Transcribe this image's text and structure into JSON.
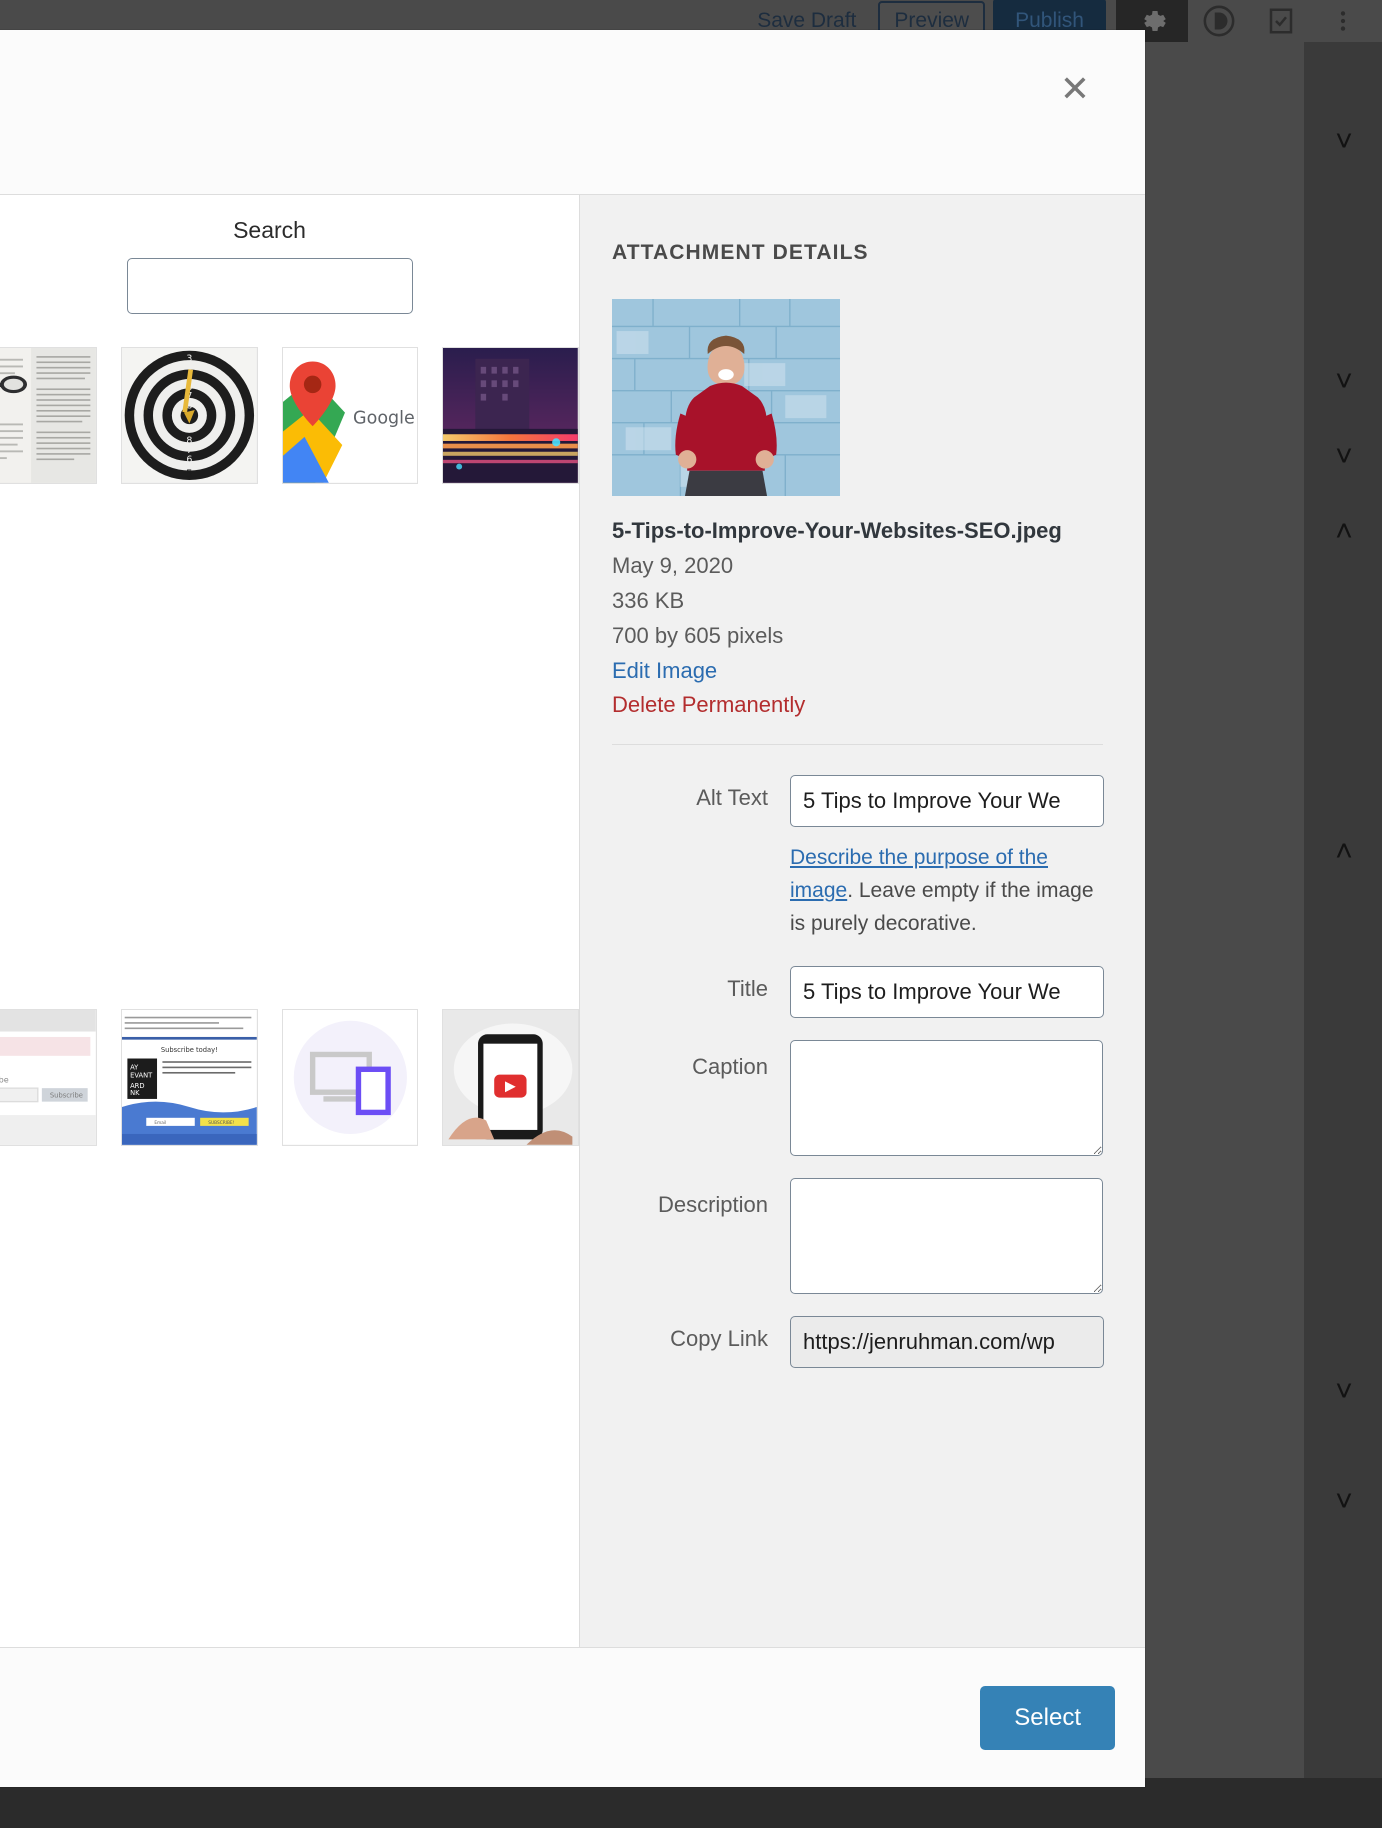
{
  "editor": {
    "save_draft_label": "Save Draft",
    "preview_label": "Preview",
    "publish_label": "Publish",
    "gear_icon": "gear-icon",
    "divi_icon": "divi-logo-icon",
    "check_icon": "checklist-icon",
    "more_icon": "more-vertical-icon"
  },
  "modal": {
    "close_icon": "close-icon",
    "search": {
      "label": "Search",
      "value": "",
      "placeholder": ""
    },
    "library": {
      "items": [
        {
          "name": "book-glasses-thumbnail"
        },
        {
          "name": "dartboard-target-thumbnail"
        },
        {
          "name": "google-maps-thumbnail"
        },
        {
          "name": "city-lights-long-exposure-thumbnail"
        },
        {
          "name": "subscribe-form-thumbnail"
        },
        {
          "name": "newsletter-signup-thumbnail"
        },
        {
          "name": "responsive-devices-icon-thumbnail"
        },
        {
          "name": "phone-youtube-thumbnail"
        }
      ]
    },
    "details": {
      "heading": "ATTACHMENT DETAILS",
      "preview_name": "man-cheering-blue-wall-preview",
      "file_name": "5-Tips-to-Improve-Your-Websites-SEO.jpeg",
      "date": "May 9, 2020",
      "file_size": "336 KB",
      "dimensions": "700 by 605 pixels",
      "edit_image_label": "Edit Image",
      "delete_label": "Delete Permanently",
      "fields": {
        "alt_text_label": "Alt Text",
        "alt_text_value": "5 Tips to Improve Your We",
        "alt_help_link": "Describe the purpose of the image",
        "alt_help_rest": ". Leave empty if the image is purely decorative.",
        "title_label": "Title",
        "title_value": "5 Tips to Improve Your We",
        "caption_label": "Caption",
        "caption_value": "",
        "description_label": "Description",
        "description_value": "",
        "copy_link_label": "Copy Link",
        "copy_link_value": "https://jenruhman.com/wp"
      }
    },
    "footer": {
      "select_label": "Select"
    }
  },
  "colors": {
    "accent": "#3582b6",
    "link": "#2b6cb0",
    "danger": "#b32d2e",
    "panel_bg": "#f1f1f1"
  }
}
